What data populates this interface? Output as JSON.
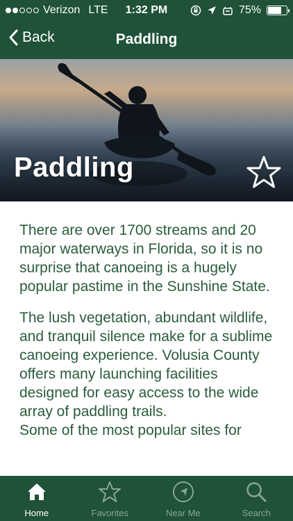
{
  "status_bar": {
    "carrier": "Verizon",
    "network": "LTE",
    "time": "1:32 PM",
    "battery": "75%",
    "battery_level": 0.75,
    "signal_bars_filled": 2,
    "signal_bars_total": 5
  },
  "nav": {
    "back_label": "Back",
    "title": "Paddling"
  },
  "hero": {
    "title": "Paddling",
    "favorite_icon": "star-outline-icon"
  },
  "content": {
    "paragraphs": [
      "There are over 1700 streams and 20 major waterways in Florida, so it is no surprise that canoeing is a hugely popular pastime in the Sunshine State.",
      "The lush vegetation, abundant wildlife, and tranquil silence make for a sublime canoeing experience. Volusia County offers many launching facilities designed for easy access to the wide array of paddling trails.",
      "Some of the most popular sites for"
    ]
  },
  "tabbar": {
    "tabs": [
      {
        "label": "Home",
        "icon": "home-icon",
        "active": true
      },
      {
        "label": "Favorites",
        "icon": "star-icon",
        "active": false
      },
      {
        "label": "Near Me",
        "icon": "compass-icon",
        "active": false
      },
      {
        "label": "Search",
        "icon": "search-icon",
        "active": false
      }
    ]
  },
  "colors": {
    "brand_green": "#1f5238",
    "text_green": "#2a5b3b",
    "inactive_tab": "#8aa597"
  }
}
